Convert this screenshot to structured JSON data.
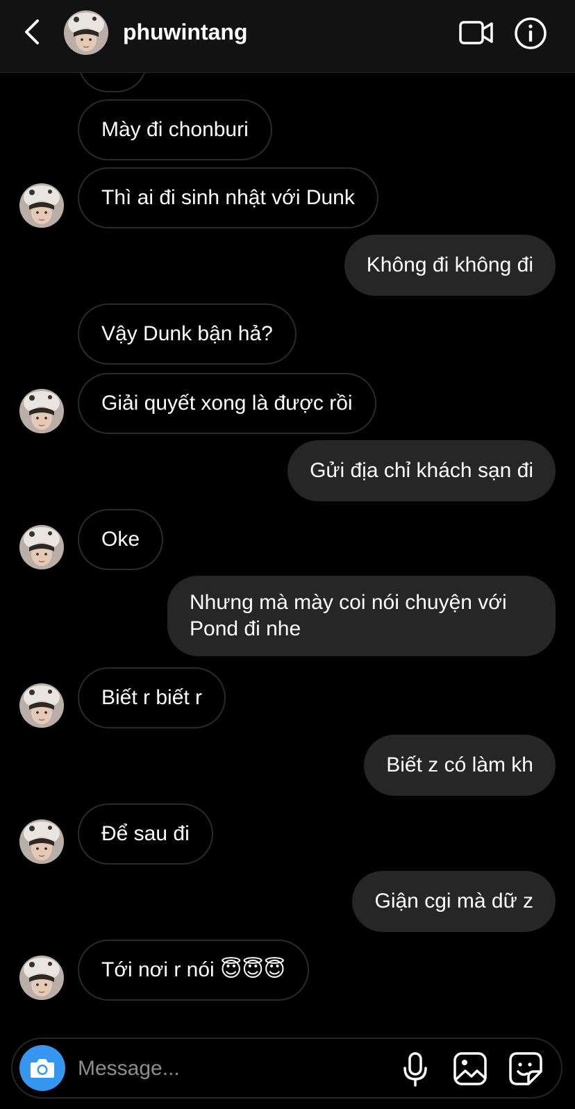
{
  "header": {
    "username": "phuwintang",
    "icons": [
      "back-chevron-icon",
      "video-call-icon",
      "info-icon"
    ]
  },
  "messages": [
    {
      "side": "in",
      "text": "",
      "avatar": false
    },
    {
      "side": "in",
      "text": "Mày đi chonburi",
      "avatar": false
    },
    {
      "side": "in",
      "text": "Thì ai đi sinh nhật với Dunk",
      "avatar": true
    },
    {
      "side": "out",
      "text": "Không đi không đi"
    },
    {
      "side": "in",
      "text": "Vậy Dunk bận hả?",
      "avatar": false
    },
    {
      "side": "in",
      "text": "Giải quyết xong là được rồi",
      "avatar": true
    },
    {
      "side": "out",
      "text": "Gửi địa chỉ khách sạn đi"
    },
    {
      "side": "in",
      "text": "Oke",
      "avatar": true
    },
    {
      "side": "out",
      "text": "Nhưng mà mày coi nói chuyện với Pond đi nhe"
    },
    {
      "side": "in",
      "text": "Biết r biết r",
      "avatar": true
    },
    {
      "side": "out",
      "text": "Biết z có làm kh"
    },
    {
      "side": "in",
      "text": "Để sau đi",
      "avatar": true
    },
    {
      "side": "out",
      "text": "Giận cgi mà dữ z"
    },
    {
      "side": "in",
      "text": "Tới nơi r nói 😇😇😇",
      "avatar": true
    }
  ],
  "composer": {
    "placeholder": "Message...",
    "icons": [
      "camera-icon",
      "microphone-icon",
      "gallery-icon",
      "sticker-icon"
    ]
  },
  "colors": {
    "background": "#000000",
    "header": "#121212",
    "outgoing_bubble": "#262626",
    "incoming_border": "#2b2b2b",
    "camera_button": "#3797f0",
    "placeholder": "#8e8e8e"
  }
}
